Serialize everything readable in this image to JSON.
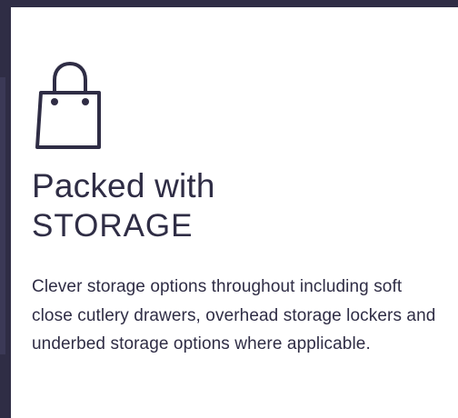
{
  "content": {
    "icon_name": "shopping-bag-icon",
    "title_line_1": "Packed with",
    "title_line_2": "STORAGE",
    "description": "Clever storage options throughout including soft close cutlery drawers, overhead storage lockers and underbed storage options where applicable."
  },
  "colors": {
    "primary": "#2f2d45",
    "background": "#ffffff"
  }
}
